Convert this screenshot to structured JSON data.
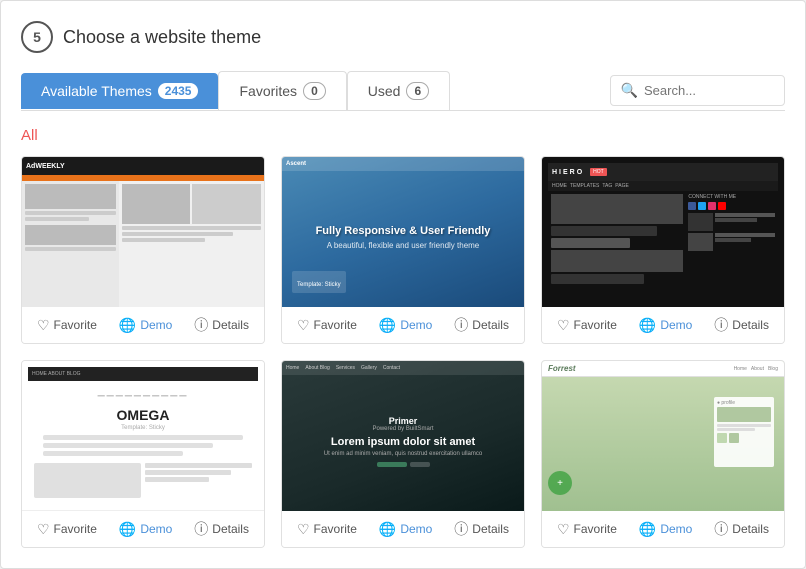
{
  "page": {
    "step": "5",
    "title": "Choose a website theme"
  },
  "tabs": [
    {
      "id": "available",
      "label": "Available Themes",
      "count": "2435",
      "active": true
    },
    {
      "id": "favorites",
      "label": "Favorites",
      "count": "0",
      "active": false
    },
    {
      "id": "used",
      "label": "Used",
      "count": "6",
      "active": false
    }
  ],
  "search": {
    "placeholder": "Search..."
  },
  "section_label": "All",
  "themes": [
    {
      "id": 1,
      "name": "Weekly",
      "type": "weekly",
      "favorite_label": "Favorite",
      "demo_label": "Demo",
      "details_label": "Details"
    },
    {
      "id": 2,
      "name": "Ascent",
      "type": "ascent",
      "tagline": "Fully Responsive & User Friendly",
      "favorite_label": "Favorite",
      "demo_label": "Demo",
      "details_label": "Details"
    },
    {
      "id": 3,
      "name": "Hiero",
      "type": "hiero",
      "favorite_label": "Favorite",
      "demo_label": "Demo",
      "details_label": "Details"
    },
    {
      "id": 4,
      "name": "Omega",
      "type": "omega",
      "favorite_label": "Favorite",
      "demo_label": "Demo",
      "details_label": "Details"
    },
    {
      "id": 5,
      "name": "Primer",
      "type": "primer",
      "tagline": "Lorem ipsum dolor sit amet",
      "favorite_label": "Favorite",
      "demo_label": "Demo",
      "details_label": "Details"
    },
    {
      "id": 6,
      "name": "Forest",
      "type": "forest",
      "favorite_label": "Favorite",
      "demo_label": "Demo",
      "details_label": "Details"
    }
  ],
  "colors": {
    "active_tab_bg": "#4a90d9",
    "demo_color": "#4a90d9",
    "section_color": "#e55555"
  }
}
